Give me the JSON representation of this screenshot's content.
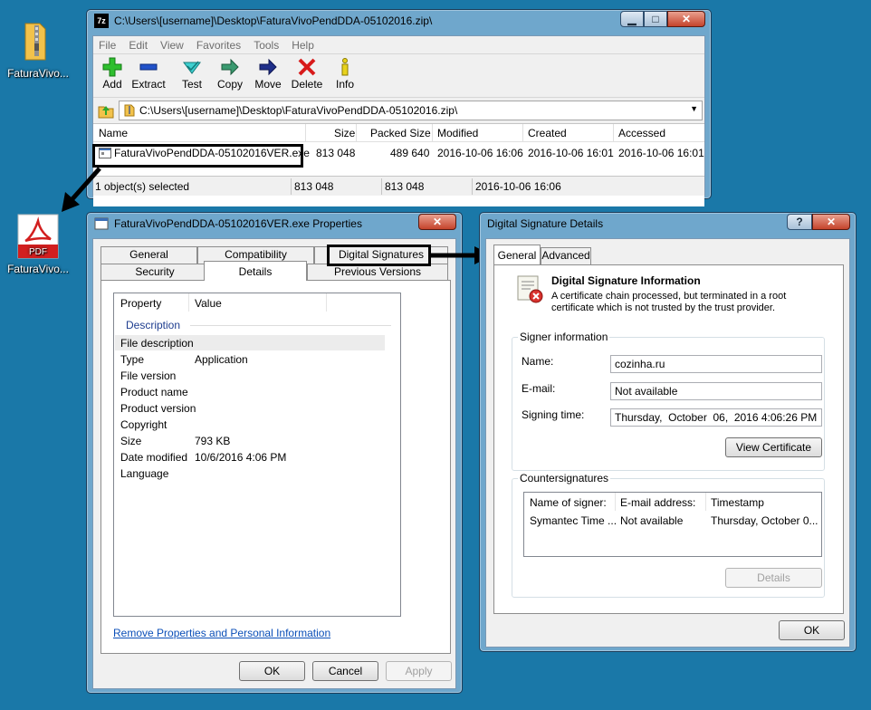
{
  "desktop": {
    "zip_icon_label": "FaturaVivo...",
    "pdf_icon_label": "FaturaVivo...",
    "pdf_badge": "PDF"
  },
  "sevenzip": {
    "title": "C:\\Users\\[username]\\Desktop\\FaturaVivoPendDDA-05102016.zip\\",
    "app_icon_text": "7z",
    "menu": [
      "File",
      "Edit",
      "View",
      "Favorites",
      "Tools",
      "Help"
    ],
    "toolbar": [
      {
        "label": "Add",
        "icon": "add-icon"
      },
      {
        "label": "Extract",
        "icon": "extract-icon"
      },
      {
        "label": "Test",
        "icon": "test-icon"
      },
      {
        "label": "Copy",
        "icon": "copy-icon"
      },
      {
        "label": "Move",
        "icon": "move-icon"
      },
      {
        "label": "Delete",
        "icon": "delete-icon"
      },
      {
        "label": "Info",
        "icon": "info-icon"
      }
    ],
    "address": "C:\\Users\\[username]\\Desktop\\FaturaVivoPendDDA-05102016.zip\\",
    "columns": [
      "Name",
      "Size",
      "Packed Size",
      "Modified",
      "Created",
      "Accessed"
    ],
    "rows": [
      {
        "name": "FaturaVivoPendDDA-05102016VER.exe",
        "size": "813 048",
        "packed": "489 640",
        "modified": "2016-10-06 16:06",
        "created": "2016-10-06 16:01",
        "accessed": "2016-10-06 16:01"
      }
    ],
    "status": {
      "selected": "1 object(s) selected",
      "size": "813 048",
      "packed": "813 048",
      "modified": "2016-10-06 16:06"
    }
  },
  "properties": {
    "title": "FaturaVivoPendDDA-05102016VER.exe Properties",
    "tabs_row1": [
      "General",
      "Compatibility",
      "Digital Signatures"
    ],
    "tabs_row2": [
      "Security",
      "Details",
      "Previous Versions"
    ],
    "list_headers": [
      "Property",
      "Value"
    ],
    "section": "Description",
    "rows": [
      {
        "prop": "File description",
        "value": ""
      },
      {
        "prop": "Type",
        "value": "Application"
      },
      {
        "prop": "File version",
        "value": ""
      },
      {
        "prop": "Product name",
        "value": ""
      },
      {
        "prop": "Product version",
        "value": ""
      },
      {
        "prop": "Copyright",
        "value": ""
      },
      {
        "prop": "Size",
        "value": "793 KB"
      },
      {
        "prop": "Date modified",
        "value": "10/6/2016 4:06 PM"
      },
      {
        "prop": "Language",
        "value": ""
      }
    ],
    "link": "Remove Properties and Personal Information",
    "buttons": {
      "ok": "OK",
      "cancel": "Cancel",
      "apply": "Apply"
    }
  },
  "signature": {
    "title": "Digital Signature Details",
    "help_button": "?",
    "tabs": [
      "General",
      "Advanced"
    ],
    "info_title": "Digital Signature Information",
    "info_text": "A certificate chain processed, but terminated in a root certificate which is not trusted by the trust provider.",
    "signer_group": "Signer information",
    "name_label": "Name:",
    "name_value": "cozinha.ru",
    "email_label": "E-mail:",
    "email_value": "Not available",
    "time_label": "Signing time:",
    "time_value": "Thursday,  October  06,  2016 4:06:26 PM",
    "view_cert": "View Certificate",
    "counter_group": "Countersignatures",
    "counter_headers": [
      "Name of signer:",
      "E-mail address:",
      "Timestamp"
    ],
    "counter_rows": [
      {
        "name": "Symantec Time ...",
        "email": "Not available",
        "timestamp": "Thursday, October 0..."
      }
    ],
    "details_button": "Details",
    "ok_button": "OK"
  }
}
